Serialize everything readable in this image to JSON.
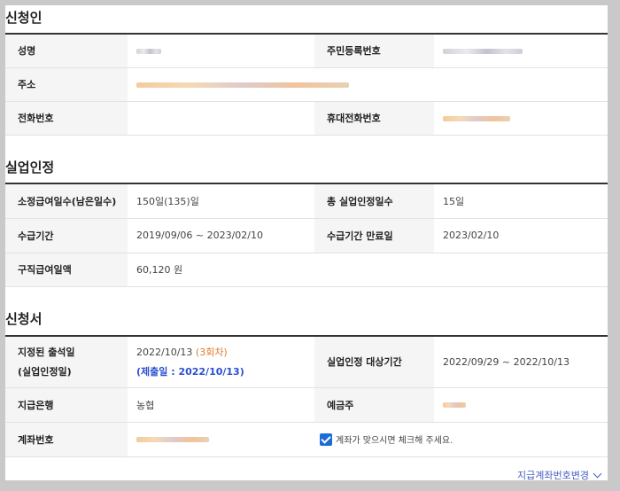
{
  "sections": {
    "applicant": {
      "title": "신청인",
      "name_label": "성명",
      "rrn_label": "주민등록번호",
      "address_label": "주소",
      "phone_label": "전화번호",
      "mobile_label": "휴대전화번호"
    },
    "recognition": {
      "title": "실업인정",
      "days_label": "소정급여일수(남은일수)",
      "days_value": "150일(135)일",
      "total_days_label": "총 실업인정일수",
      "total_days_value": "15일",
      "period_label": "수급기간",
      "period_value": "2019/09/06 ~ 2023/02/10",
      "period_end_label": "수급기간 만료일",
      "period_end_value": "2023/02/10",
      "daily_amount_label": "구직급여일액",
      "daily_amount_value": "60,120 원"
    },
    "application": {
      "title": "신청서",
      "attendance_label_1": "지정된 출석일",
      "attendance_label_2": "(실업인정일)",
      "attendance_date": "2022/10/13",
      "attendance_round": "(3회차)",
      "submit_date": "(제출일 : 2022/10/13)",
      "target_period_label": "실업인정 대상기간",
      "target_period_value": "2022/09/29  ~  2022/10/13",
      "bank_label": "지급은행",
      "bank_value": "농협",
      "holder_label": "예금주",
      "account_label": "계좌번호",
      "confirm_text": "계좌가 맞으시면 체크해 주세요.",
      "confirm_checked": true
    }
  },
  "footer": {
    "change_account_link": "지급계좌번호변경"
  },
  "colors": {
    "accent_blue": "#2b4fd1",
    "round_orange": "#e07a2b",
    "checkbox_blue": "#1d6bd6"
  }
}
